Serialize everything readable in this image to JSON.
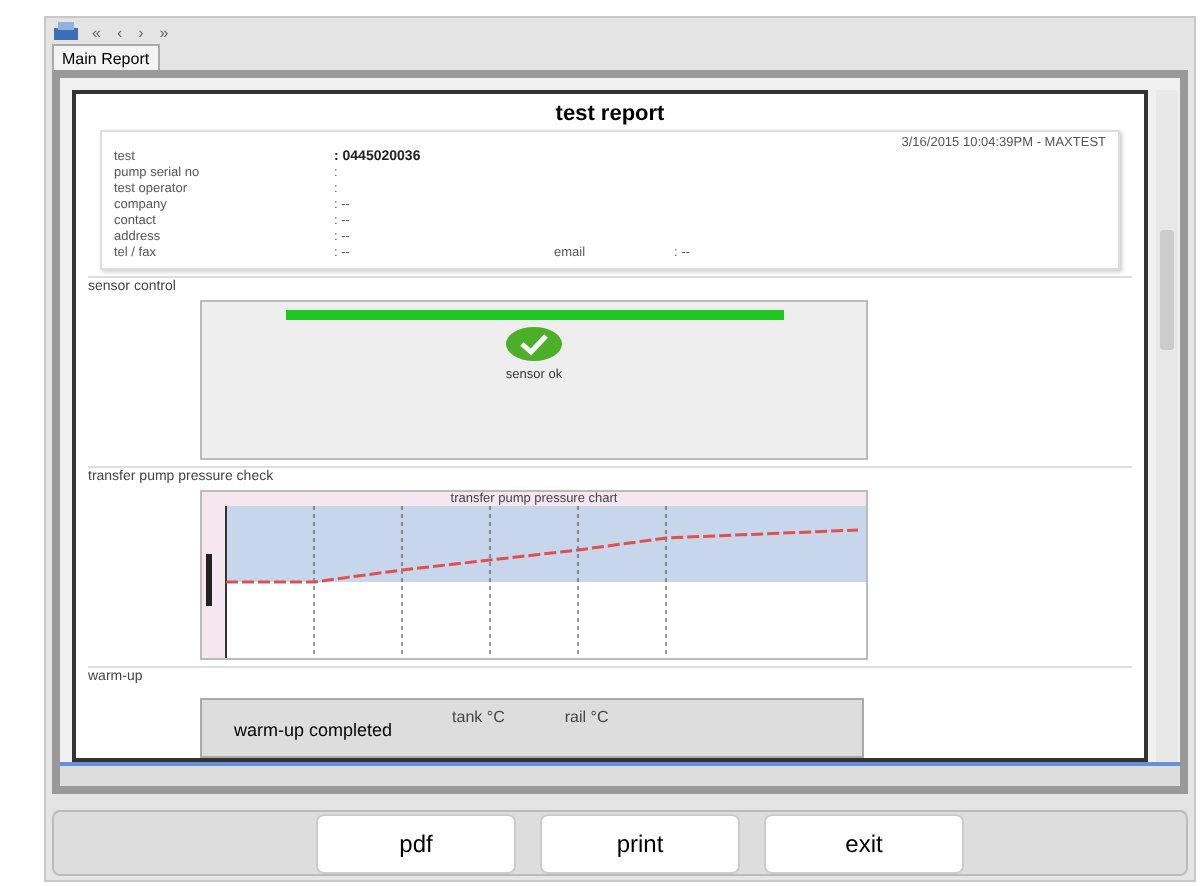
{
  "toolbar": {
    "nav": [
      "«",
      "‹",
      "›",
      "»"
    ]
  },
  "tabs": [
    {
      "label": "Main Report",
      "selected": true
    }
  ],
  "report": {
    "title": "test report",
    "timestamp": "3/16/2015 10:04:39PM - MAXTEST",
    "fields": [
      {
        "label": "test",
        "value": ": 0445020036",
        "bold": true
      },
      {
        "label": "pump serial no",
        "value": ":",
        "bold": false
      },
      {
        "label": "test operator",
        "value": ":",
        "bold": false
      },
      {
        "label": "company",
        "value": ": --",
        "bold": false
      },
      {
        "label": "contact",
        "value": ": --",
        "bold": false
      },
      {
        "label": "address",
        "value": ": --",
        "bold": false
      },
      {
        "label": "tel / fax",
        "value": ": --",
        "bold": false,
        "extra_label": "email",
        "extra_value": ": --"
      }
    ],
    "sensor": {
      "heading": "sensor control",
      "level": 1,
      "status": "sensor ok"
    },
    "pressure": {
      "heading": "transfer pump pressure check",
      "chart_title": "transfer pump pressure chart"
    },
    "warmup": {
      "heading": "warm-up",
      "status": "warm-up completed",
      "columns": [
        "tank °C",
        "rail °C"
      ]
    }
  },
  "buttons": [
    "pdf",
    "print",
    "exit"
  ]
}
